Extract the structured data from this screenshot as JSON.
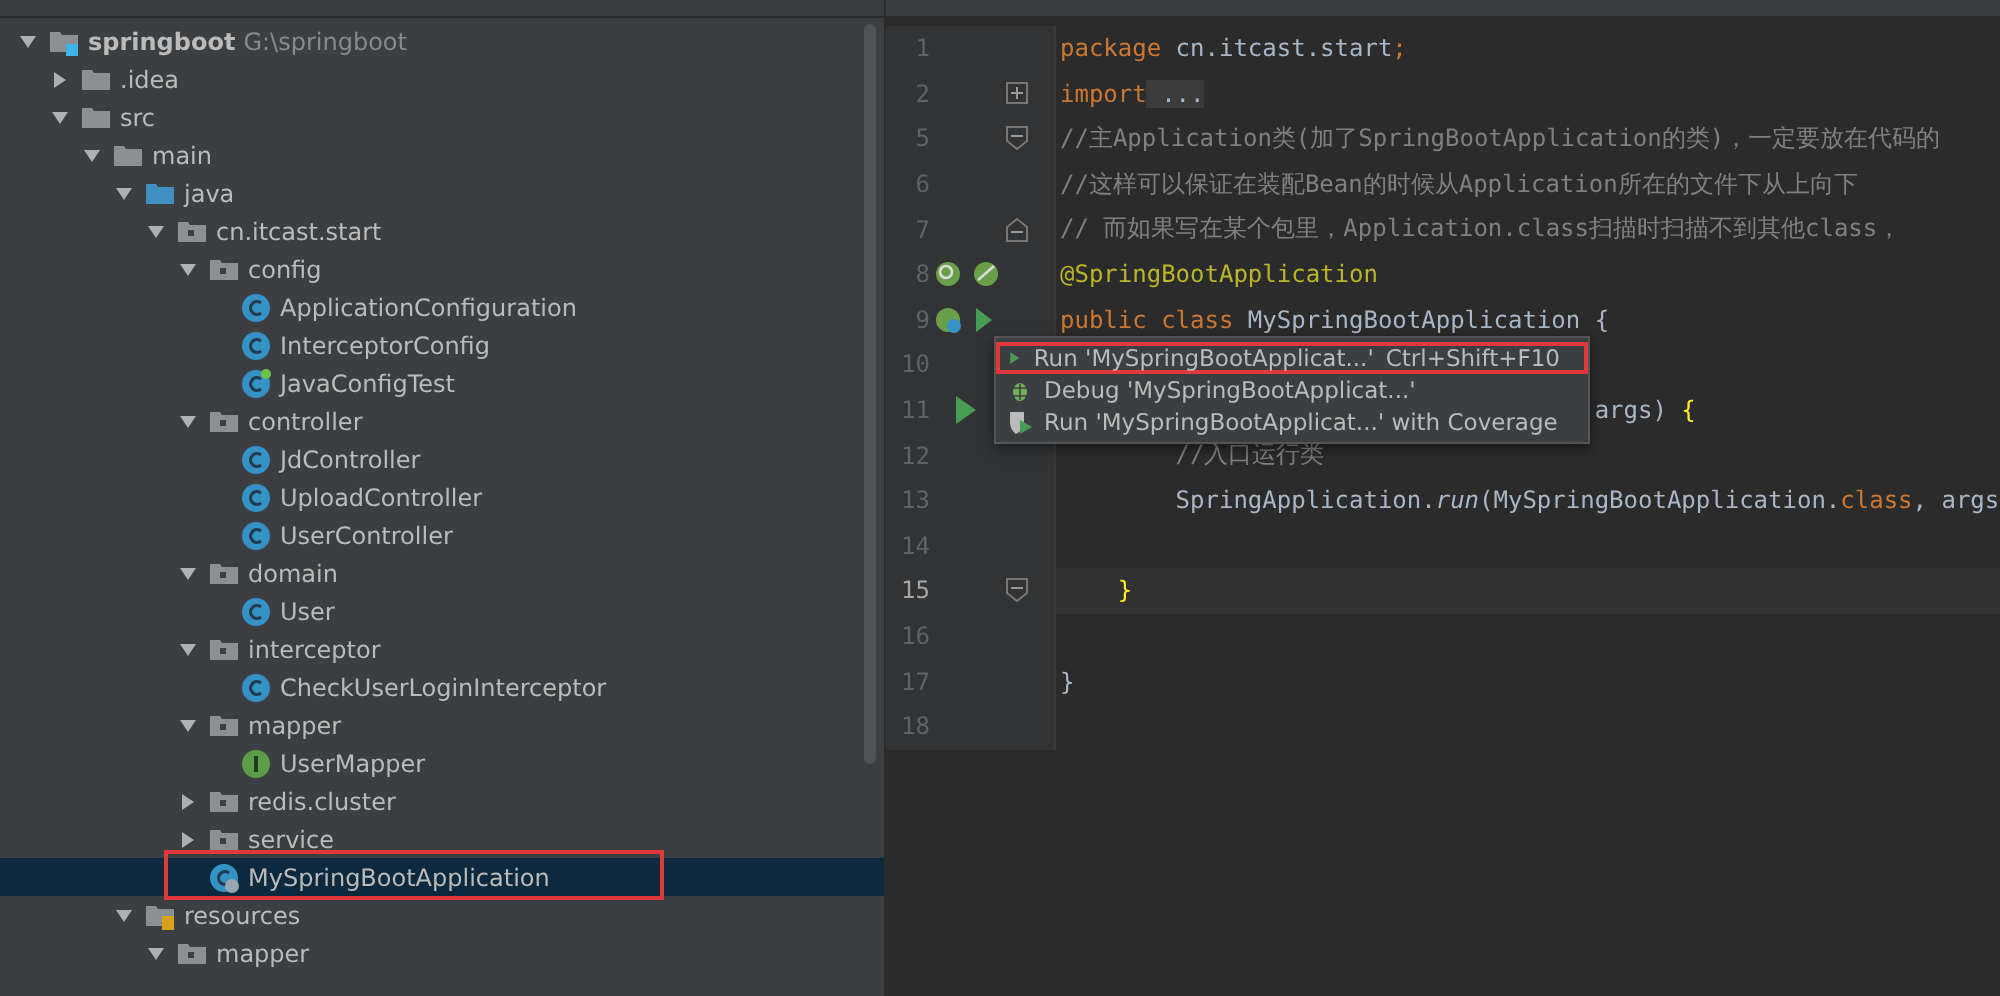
{
  "project_tree": {
    "items": [
      {
        "label": "springboot",
        "path": "G:\\springboot",
        "kind": "module",
        "expanded": true,
        "selected": false,
        "highlighted": false,
        "children": [
          {
            "label": ".idea",
            "kind": "folder",
            "expanded": false,
            "selected": false,
            "highlighted": false
          },
          {
            "label": "src",
            "kind": "folder",
            "expanded": true,
            "selected": false,
            "highlighted": false,
            "children": [
              {
                "label": "main",
                "kind": "folder",
                "expanded": true,
                "selected": false,
                "highlighted": false,
                "children": [
                  {
                    "label": "java",
                    "kind": "source-folder",
                    "expanded": true,
                    "selected": false,
                    "highlighted": false,
                    "children": [
                      {
                        "label": "cn.itcast.start",
                        "kind": "package",
                        "expanded": true,
                        "selected": false,
                        "highlighted": false,
                        "children": [
                          {
                            "label": "config",
                            "kind": "package",
                            "expanded": true,
                            "selected": false,
                            "highlighted": false,
                            "children": [
                              {
                                "label": "ApplicationConfiguration",
                                "kind": "class",
                                "selected": false,
                                "highlighted": false
                              },
                              {
                                "label": "InterceptorConfig",
                                "kind": "class",
                                "selected": false,
                                "highlighted": false
                              },
                              {
                                "label": "JavaConfigTest",
                                "kind": "test-class",
                                "selected": false,
                                "highlighted": false
                              }
                            ]
                          },
                          {
                            "label": "controller",
                            "kind": "package",
                            "expanded": true,
                            "selected": false,
                            "highlighted": false,
                            "children": [
                              {
                                "label": "JdController",
                                "kind": "class",
                                "selected": false,
                                "highlighted": false
                              },
                              {
                                "label": "UploadController",
                                "kind": "class",
                                "selected": false,
                                "highlighted": false
                              },
                              {
                                "label": "UserController",
                                "kind": "class",
                                "selected": false,
                                "highlighted": false
                              }
                            ]
                          },
                          {
                            "label": "domain",
                            "kind": "package",
                            "expanded": true,
                            "selected": false,
                            "highlighted": false,
                            "children": [
                              {
                                "label": "User",
                                "kind": "class",
                                "selected": false,
                                "highlighted": false
                              }
                            ]
                          },
                          {
                            "label": "interceptor",
                            "kind": "package",
                            "expanded": true,
                            "selected": false,
                            "highlighted": false,
                            "children": [
                              {
                                "label": "CheckUserLoginInterceptor",
                                "kind": "class",
                                "selected": false,
                                "highlighted": false
                              }
                            ]
                          },
                          {
                            "label": "mapper",
                            "kind": "package",
                            "expanded": true,
                            "selected": false,
                            "highlighted": false,
                            "children": [
                              {
                                "label": "UserMapper",
                                "kind": "interface",
                                "selected": false,
                                "highlighted": false
                              }
                            ]
                          },
                          {
                            "label": "redis.cluster",
                            "kind": "package",
                            "expanded": false,
                            "selected": false,
                            "highlighted": false
                          },
                          {
                            "label": "service",
                            "kind": "package",
                            "expanded": false,
                            "selected": false,
                            "highlighted": false
                          },
                          {
                            "label": "MySpringBootApplication",
                            "kind": "app-class",
                            "selected": true,
                            "highlighted": true
                          }
                        ]
                      }
                    ]
                  },
                  {
                    "label": "resources",
                    "kind": "resource-folder",
                    "expanded": true,
                    "selected": false,
                    "highlighted": false,
                    "children": [
                      {
                        "label": "mapper",
                        "kind": "package",
                        "expanded": true,
                        "selected": false,
                        "highlighted": false
                      }
                    ]
                  }
                ]
              }
            ]
          }
        ]
      }
    ]
  },
  "editor": {
    "lines": [
      {
        "number": "1",
        "current": false,
        "tokens": [
          {
            "text": "package",
            "kind": "keyword"
          },
          {
            "text": " cn.itcast.start",
            "kind": "plain"
          },
          {
            "text": ";",
            "kind": "keyword"
          }
        ]
      },
      {
        "number": "2",
        "fold": {
          "kind": "expand"
        },
        "current": false,
        "tokens": [
          {
            "text": "import",
            "kind": "keyword"
          },
          {
            "text": " ...",
            "kind": "folded"
          }
        ]
      },
      {
        "number": "5",
        "fold": {
          "kind": "collapse"
        },
        "current": false,
        "tokens": [
          {
            "text": "//主Application类(加了SpringBootApplication的类)，一定要放在代码的",
            "kind": "comment"
          }
        ]
      },
      {
        "number": "6",
        "current": false,
        "tokens": [
          {
            "text": "//这样可以保证在装配Bean的时候从Application所在的文件下从上向下",
            "kind": "comment"
          }
        ]
      },
      {
        "number": "7",
        "fold": {
          "kind": "end"
        },
        "current": false,
        "tokens": [
          {
            "text": "// 而如果写在某个包里，Application.class扫描时扫描不到其他class，",
            "kind": "comment"
          }
        ]
      },
      {
        "number": "8",
        "gutter_icon": {
          "kind": "bean"
        },
        "current": false,
        "tokens": [
          {
            "text": "@SpringBootApplication",
            "kind": "annotation"
          }
        ]
      },
      {
        "number": "9",
        "gutter_icon": {
          "kind": "run-bean"
        },
        "current": false,
        "tokens": [
          {
            "text": "public class ",
            "kind": "keyword"
          },
          {
            "text": "MySpringBootApplication {",
            "kind": "plain"
          }
        ]
      },
      {
        "number": "10",
        "current": false
      },
      {
        "number": "11",
        "gutter_icon": {
          "kind": "run"
        },
        "current": false,
        "tokens": [
          {
            "text": "                                     args) ",
            "kind": "plain"
          },
          {
            "text": "{",
            "kind": "brace"
          }
        ]
      },
      {
        "number": "12",
        "current": false,
        "tokens": [
          {
            "text": "        //入口运行类",
            "kind": "comment"
          }
        ]
      },
      {
        "number": "13",
        "current": false,
        "tokens": [
          {
            "text": "        SpringApplication.",
            "kind": "plain"
          },
          {
            "text": "run",
            "kind": "italic"
          },
          {
            "text": "(MySpringBootApplication.",
            "kind": "plain"
          },
          {
            "text": "class",
            "kind": "keyword"
          },
          {
            "text": ", args",
            "kind": "plain"
          }
        ]
      },
      {
        "number": "14",
        "current": false
      },
      {
        "number": "15",
        "fold": {
          "kind": "collapse"
        },
        "current": true,
        "tokens": [
          {
            "text": "    }",
            "kind": "brace"
          }
        ]
      },
      {
        "number": "16",
        "current": false
      },
      {
        "number": "17",
        "current": false,
        "tokens": [
          {
            "text": "}",
            "kind": "plain"
          }
        ]
      },
      {
        "number": "18",
        "current": false
      }
    ]
  },
  "run_menu": {
    "items": [
      {
        "kind": "run",
        "label": "Run 'MySpringBootApplicat...'",
        "shortcut": "Ctrl+Shift+F10",
        "selected": false,
        "highlighted": true
      },
      {
        "kind": "debug",
        "label": "Debug 'MySpringBootApplicat...'",
        "selected": false,
        "highlighted": false
      },
      {
        "kind": "coverage",
        "label": "Run 'MySpringBootApplicat...' with Coverage",
        "selected": false,
        "highlighted": false
      }
    ]
  }
}
